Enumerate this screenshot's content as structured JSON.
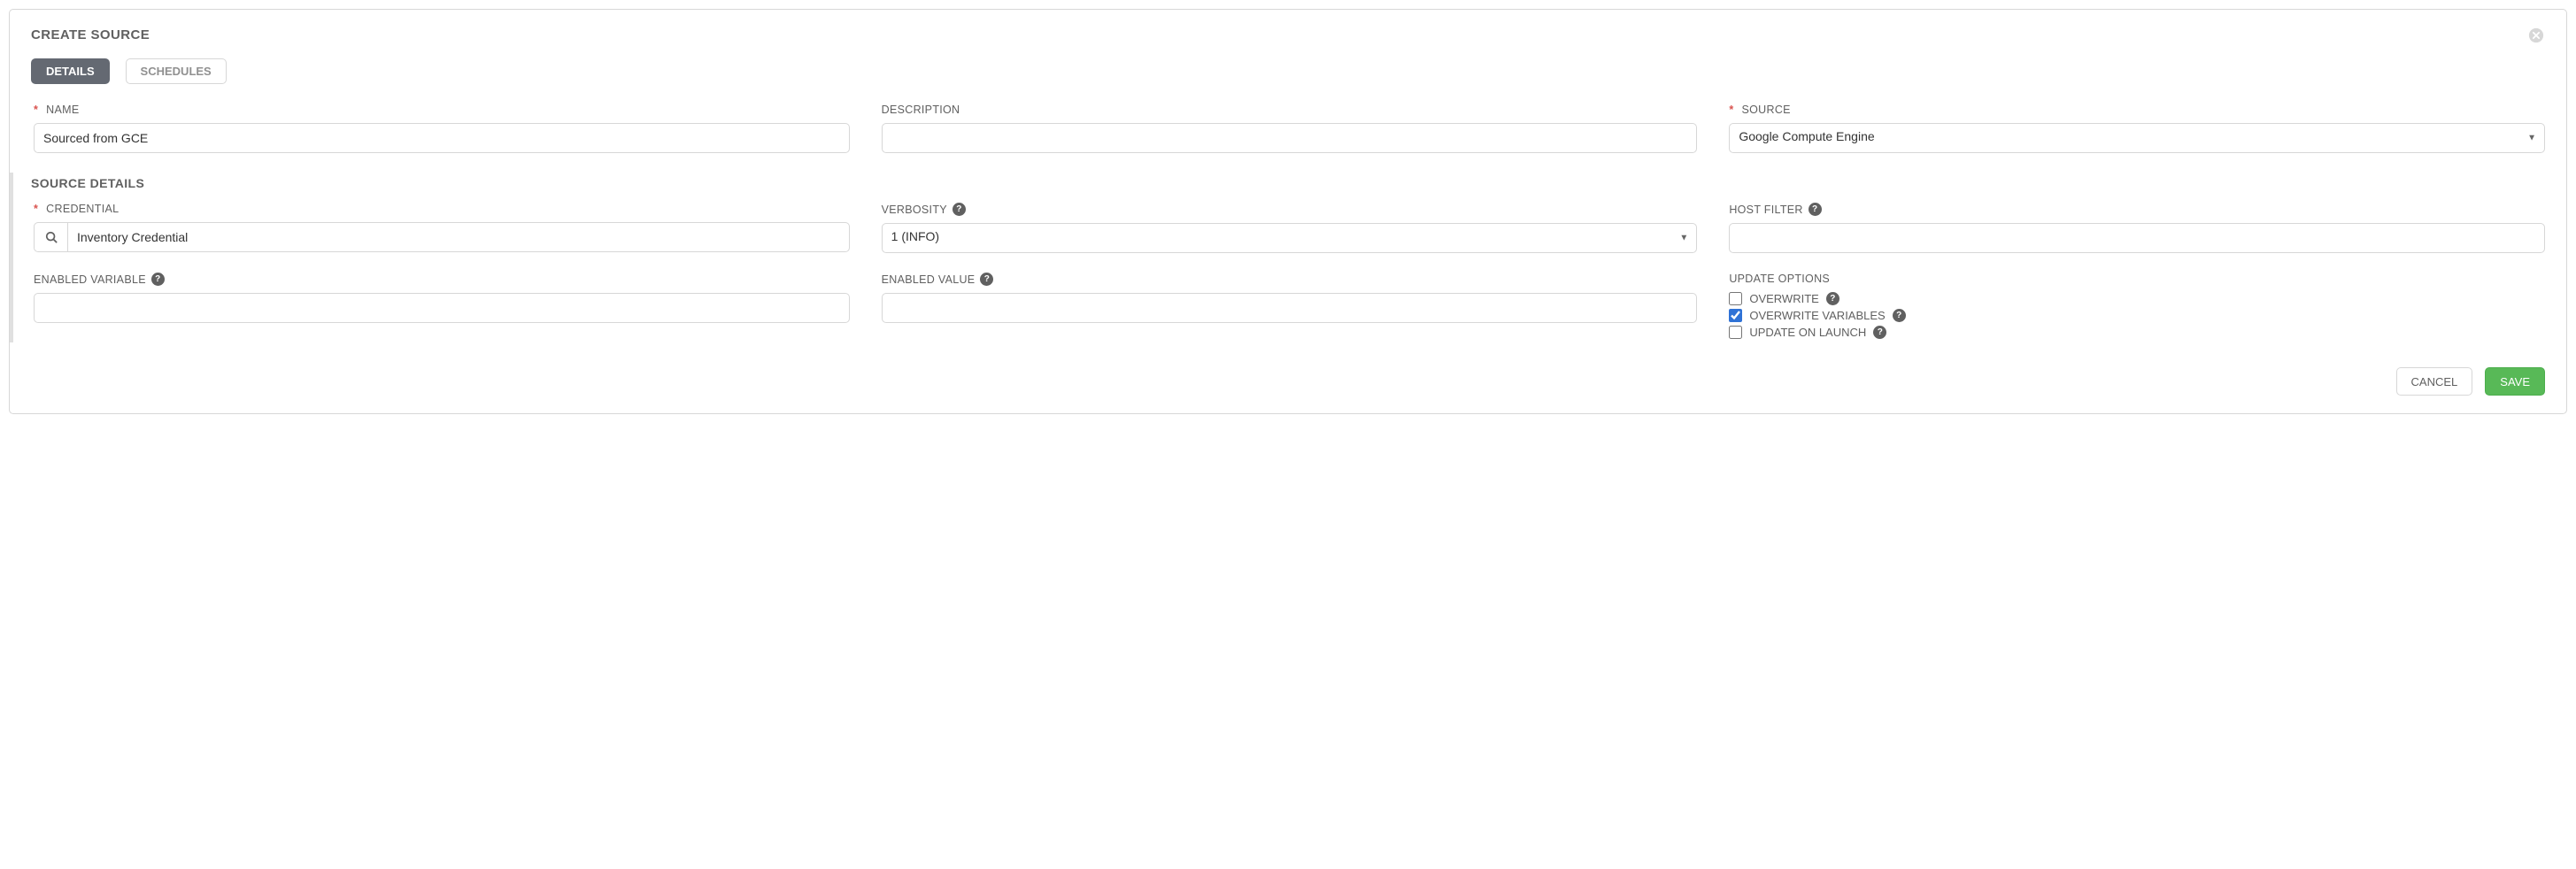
{
  "panel": {
    "title": "CREATE SOURCE"
  },
  "tabs": {
    "details": "DETAILS",
    "schedules": "SCHEDULES"
  },
  "fields": {
    "name": {
      "label": "NAME",
      "value": "Sourced from GCE"
    },
    "description": {
      "label": "DESCRIPTION",
      "value": ""
    },
    "source": {
      "label": "SOURCE",
      "value": "Google Compute Engine"
    },
    "section_title": "SOURCE DETAILS",
    "credential": {
      "label": "CREDENTIAL",
      "value": "Inventory Credential"
    },
    "verbosity": {
      "label": "VERBOSITY",
      "value": "1 (INFO)"
    },
    "host_filter": {
      "label": "HOST FILTER",
      "value": ""
    },
    "enabled_variable": {
      "label": "ENABLED VARIABLE",
      "value": ""
    },
    "enabled_value": {
      "label": "ENABLED VALUE",
      "value": ""
    },
    "update_options": {
      "label": "UPDATE OPTIONS",
      "overwrite": {
        "label": "OVERWRITE",
        "checked": false
      },
      "overwrite_variables": {
        "label": "OVERWRITE VARIABLES",
        "checked": true
      },
      "update_on_launch": {
        "label": "UPDATE ON LAUNCH",
        "checked": false
      }
    }
  },
  "footer": {
    "cancel": "CANCEL",
    "save": "SAVE"
  }
}
